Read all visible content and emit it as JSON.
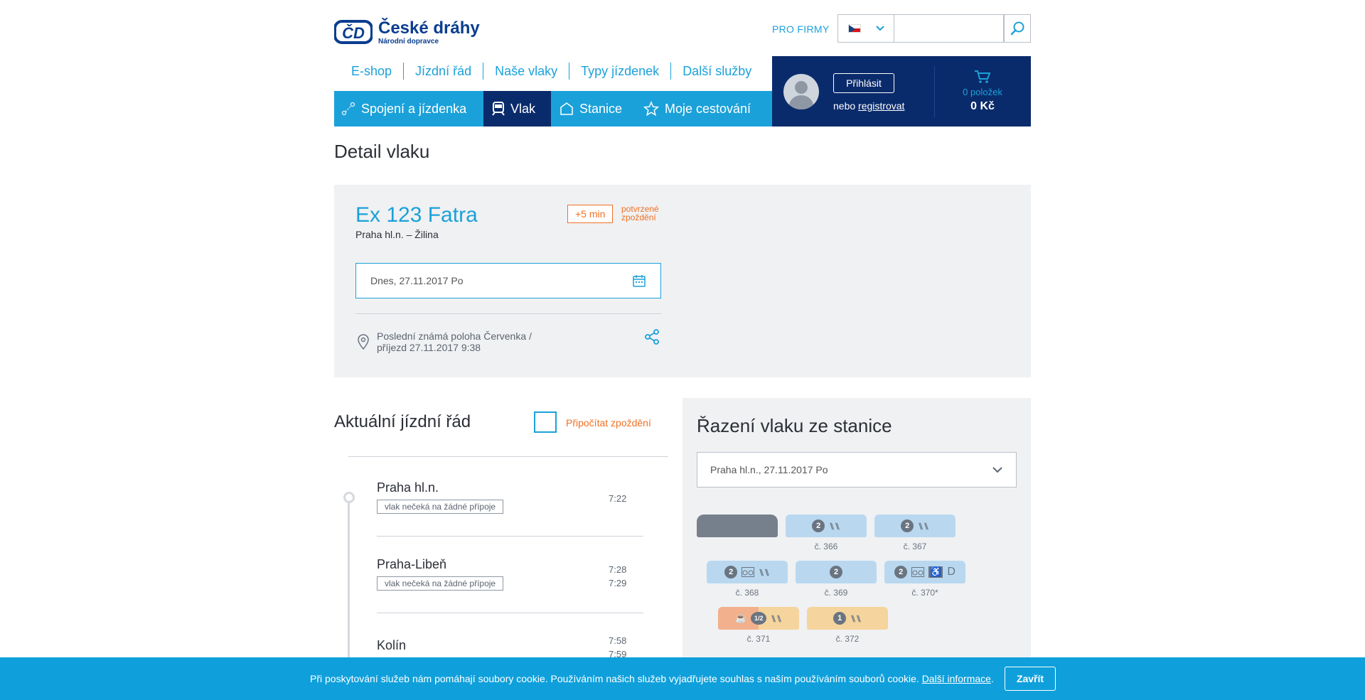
{
  "brand": {
    "name": "České dráhy",
    "tagline": "Národní dopravce",
    "logo_mark": "ČD"
  },
  "header": {
    "pro_firmy": "PRO FIRMY",
    "language_flag": "cz-flag-icon",
    "search_placeholder": "",
    "search_icon": "search-icon"
  },
  "top_nav": [
    "E-shop",
    "Jízdní řád",
    "Naše vlaky",
    "Typy jízdenek",
    "Další služby"
  ],
  "main_nav": [
    {
      "label": "Spojení a jízdenka",
      "icon": "route-icon",
      "active": false
    },
    {
      "label": "Vlak",
      "icon": "train-icon",
      "active": true
    },
    {
      "label": "Stanice",
      "icon": "station-icon",
      "active": false
    },
    {
      "label": "Moje cestování",
      "icon": "star-icon",
      "active": false
    }
  ],
  "user": {
    "login_label": "Přihlásit",
    "or_text": "nebo",
    "register_label": "registrovat"
  },
  "cart": {
    "count": "0 položek",
    "total": "0 Kč"
  },
  "page_title": "Detail vlaku",
  "train": {
    "name": "Ex 123 Fatra",
    "route": "Praha hl.n. – Žilina",
    "delay": "+5 min",
    "delay_note": "potvrzené zpoždění",
    "date": "Dnes, 27.11.2017 Po",
    "location": "Poslední známá poloha Červenka / příjezd 27.11.2017 9:38"
  },
  "timetable": {
    "title": "Aktuální jízdní řád",
    "add_delay_label": "Připočítat zpoždění",
    "stops": [
      {
        "name": "Praha hl.n.",
        "tag": "vlak nečeká na žádné přípoje",
        "arrival": "",
        "departure": "7:22"
      },
      {
        "name": "Praha-Libeň",
        "tag": "vlak nečeká na žádné přípoje",
        "arrival": "7:28",
        "departure": "7:29"
      },
      {
        "name": "Kolín",
        "tag": "",
        "arrival": "7:58",
        "departure": "7:59"
      }
    ]
  },
  "composition": {
    "title": "Řazení vlaku ze stanice",
    "station_select": "Praha hl.n., 27.11.2017 Po",
    "cars": [
      {
        "label": "",
        "type": "loco"
      },
      {
        "label": "č. 366",
        "class": "2",
        "icons": "⑊⑊"
      },
      {
        "label": "č. 367",
        "class": "2",
        "icons": "⑊⑊"
      },
      {
        "label": "č. 368",
        "class": "2",
        "icons": "bike ⑊⑊"
      },
      {
        "label": "č. 369",
        "class": "2",
        "icons": ""
      },
      {
        "label": "č. 370*",
        "class": "2",
        "icons": "bike ♿ D"
      },
      {
        "label": "č. 371",
        "class": "1/2",
        "icons": "☕ ⑊⑊"
      },
      {
        "label": "č. 372",
        "class": "1",
        "icons": "⑊⑊"
      }
    ]
  },
  "cookie": {
    "text": "Při poskytování služeb nám pomáhají soubory cookie. Používáním našich služeb vyjadřujete souhlas s naším používáním souborů cookie.",
    "more_link": "Další informace",
    "accept_label": "Zavřít"
  },
  "colors": {
    "primary": "#1ba1d9",
    "navy": "#0a2b6b",
    "orange": "#f07124",
    "panel": "#f0f1f3"
  }
}
